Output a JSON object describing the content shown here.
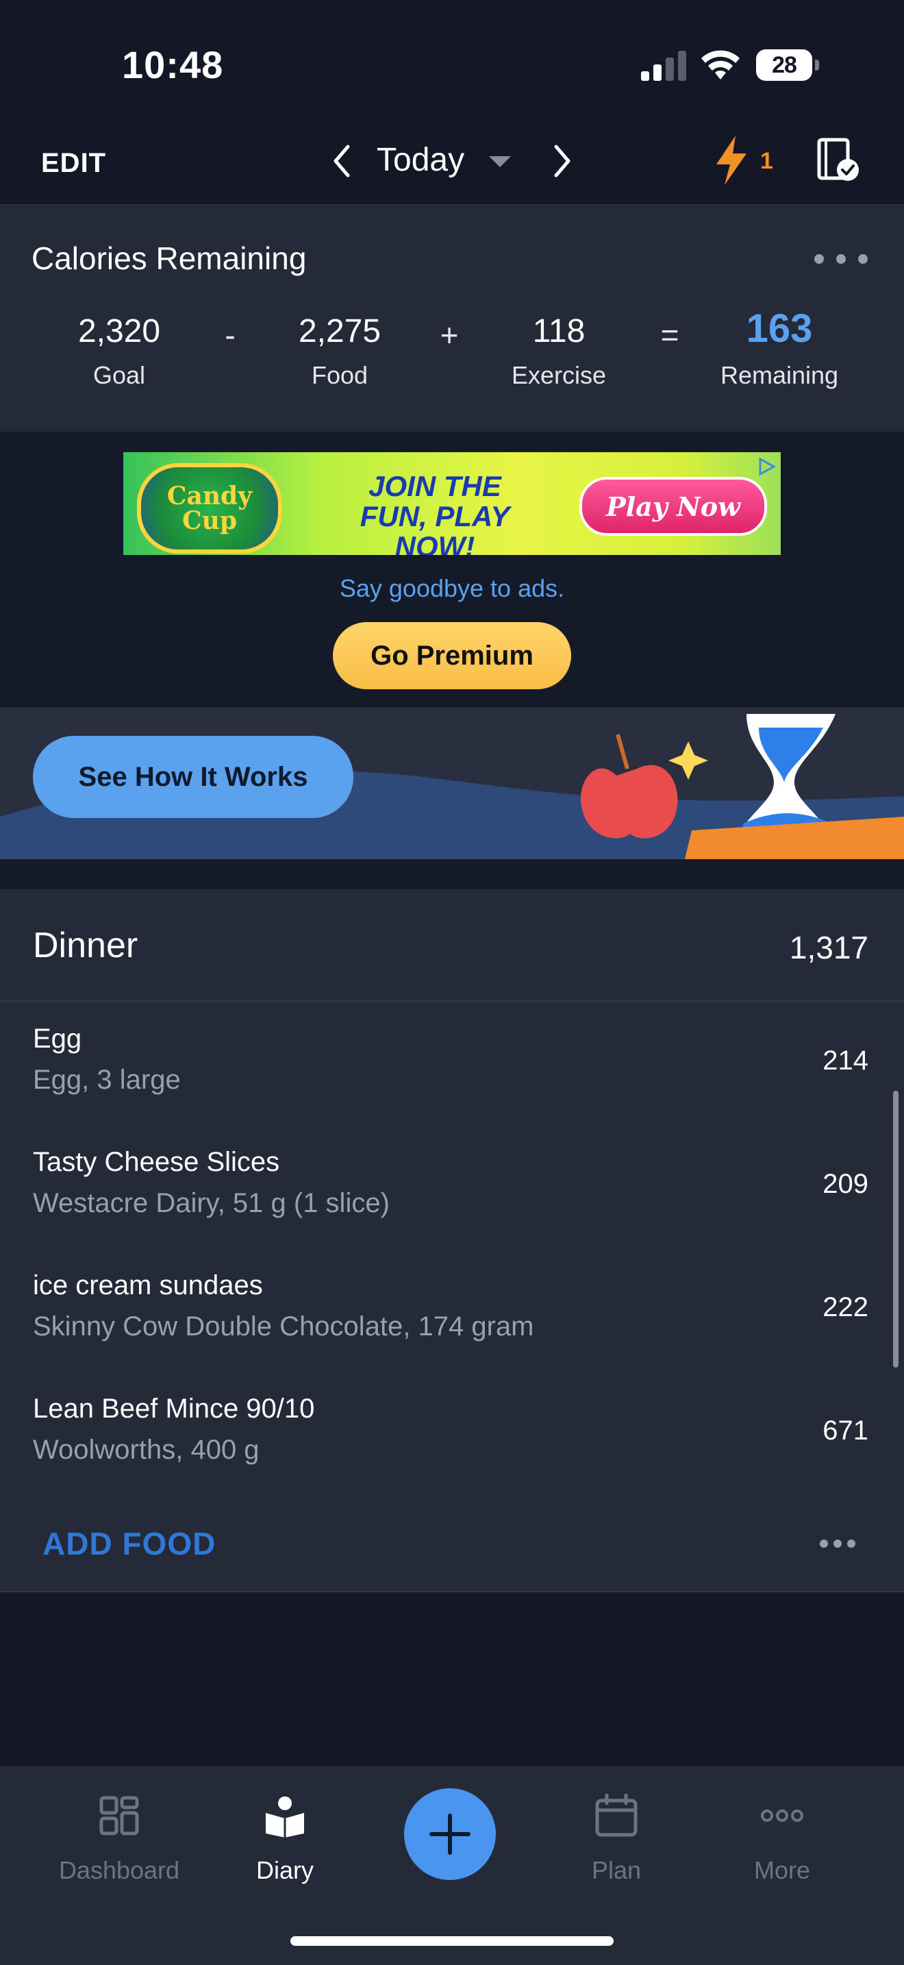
{
  "status_bar": {
    "time": "10:48",
    "battery": "28"
  },
  "top_nav": {
    "edit_label": "EDIT",
    "date_label": "Today",
    "streak_count": "1",
    "icons": [
      "chevron-left-icon",
      "chevron-right-icon",
      "lightning-icon",
      "journal-check-icon"
    ]
  },
  "calories": {
    "title": "Calories Remaining",
    "goal_value": "2,320",
    "goal_label": "Goal",
    "minus": "-",
    "food_value": "2,275",
    "food_label": "Food",
    "plus": "+",
    "exercise_value": "118",
    "exercise_label": "Exercise",
    "equals": "=",
    "remaining_value": "163",
    "remaining_label": "Remaining"
  },
  "ad": {
    "logo_text": "Candy Cup",
    "headline": "JOIN THE FUN, PLAY NOW!",
    "cta": "Play Now",
    "tagline": "Say goodbye to ads.",
    "premium_button": "Go Premium"
  },
  "promo": {
    "button_label": "See How It Works"
  },
  "meal": {
    "name": "Dinner",
    "total": "1,317",
    "items": [
      {
        "name": "Egg",
        "desc": "Egg, 3 large",
        "calories": "214"
      },
      {
        "name": "Tasty Cheese Slices",
        "desc": "Westacre Dairy, 51 g (1 slice)",
        "calories": "209"
      },
      {
        "name": "ice cream sundaes",
        "desc": "Skinny Cow Double Chocolate, 174 gram",
        "calories": "222"
      },
      {
        "name": "Lean Beef Mince 90/10",
        "desc": "Woolworths, 400 g",
        "calories": "671"
      }
    ],
    "add_food_label": "ADD FOOD"
  },
  "tabbar": {
    "tabs": [
      {
        "label": "Dashboard",
        "icon": "dashboard-grid-icon"
      },
      {
        "label": "Diary",
        "icon": "diary-book-icon"
      },
      {
        "label": "Plan",
        "icon": "calendar-icon"
      },
      {
        "label": "More",
        "icon": "more-dots-icon"
      }
    ],
    "active": "Diary"
  },
  "colors": {
    "accent_blue": "#5aa2ee",
    "add_food_blue": "#2f78d8",
    "premium_yellow": "#f8bd46",
    "streak_orange": "#f29127"
  }
}
